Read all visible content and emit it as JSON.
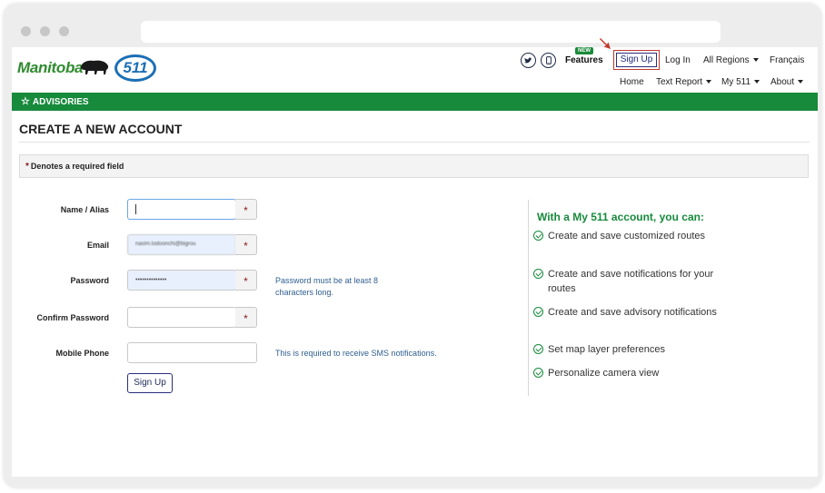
{
  "header": {
    "logo_text": "Manitoba",
    "badge_text": "511",
    "features_label": "Features",
    "new_badge": "NEW",
    "signup_label": "Sign Up",
    "login_label": "Log In",
    "regions_label": "All Regions",
    "language_label": "Français",
    "nav": {
      "home": "Home",
      "text_report": "Text Report",
      "my511": "My 511",
      "about": "About"
    }
  },
  "advisories_label": "ADVISORIES",
  "page_title": "CREATE A NEW ACCOUNT",
  "required_note": "Denotes a required field",
  "required_marker": "*",
  "form": {
    "name_label": "Name / Alias",
    "name_value": "",
    "email_label": "Email",
    "email_value": "nasim.todoonchi@bigrou",
    "password_label": "Password",
    "password_value": "••••••••••••••",
    "password_help": "Password must be at least 8 characters long.",
    "confirm_label": "Confirm Password",
    "confirm_value": "",
    "phone_label": "Mobile Phone",
    "phone_value": "",
    "phone_help": "This is required to receive SMS notifications.",
    "submit_label": "Sign Up"
  },
  "benefits": {
    "title": "With a My 511 account, you can:",
    "items": [
      "Create and save customized routes",
      "Create and save notifications for your routes",
      "Create and save advisory notifications",
      "Set map layer preferences",
      "Personalize camera view"
    ]
  },
  "colors": {
    "brand_green": "#178a3c",
    "brand_blue": "#1b6fb5",
    "required_red": "#8b1a1a",
    "highlight_red": "#c0392b"
  }
}
